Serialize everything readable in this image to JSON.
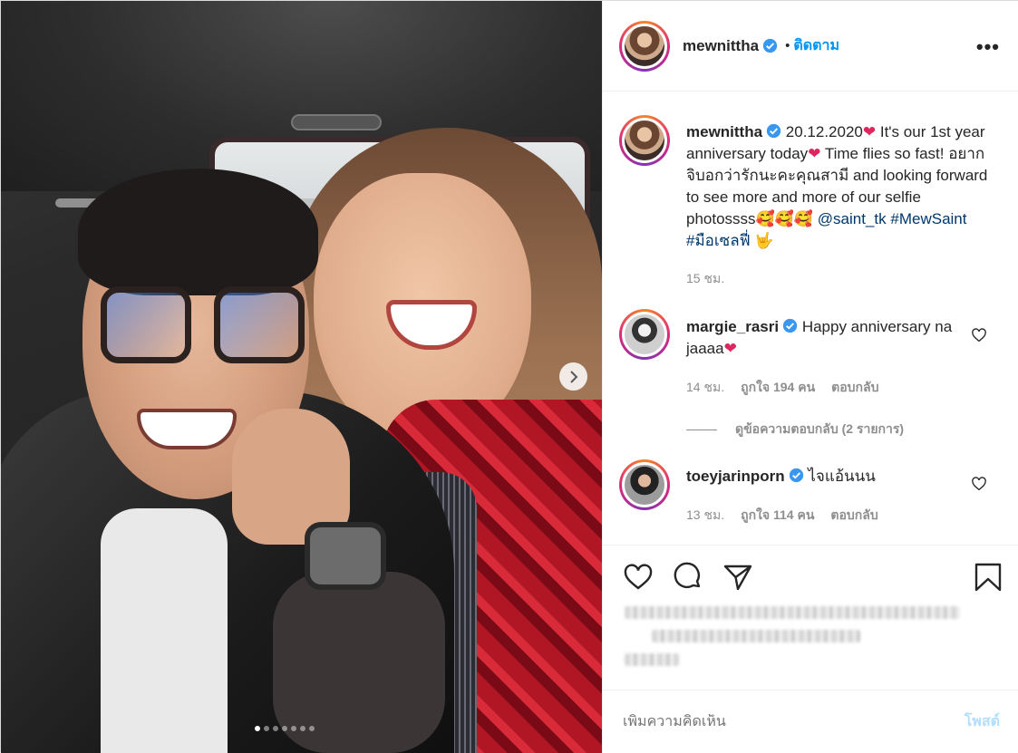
{
  "post": {
    "username": "mewnittha",
    "separator": "•",
    "follow_label": "ติดตาม",
    "more_label": "•••",
    "caption": {
      "part1": "20.12.2020",
      "part2": " It's our 1st year anniversary today",
      "part3": " Time flies so fast! อยากจิบอกว่ารักนะคะคุณสามี and looking forward to see more and more of our selfie photossss",
      "emoji_faces": "🥰🥰🥰",
      "mention": "@saint_tk",
      "hashtag1": "#MewSaint",
      "hashtag2": "#มือเซลฟี่",
      "time": "15 ชม."
    },
    "comments": [
      {
        "username": "margie_rasri",
        "text": "Happy anniversary na jaaaa",
        "time": "14 ชม.",
        "likes": "ถูกใจ 194 คน",
        "reply": "ตอบกลับ",
        "view_replies": "ดูข้อความตอบกลับ (2 รายการ)"
      },
      {
        "username": "toeyjarinporn",
        "text": "ไจแอ้นนน",
        "time": "13 ชม.",
        "likes": "ถูกใจ 114 คน",
        "reply": "ตอบกลับ"
      }
    ],
    "add_comment_placeholder": "เพิ่มความคิดเห็น",
    "post_button": "โพสต์",
    "carousel": {
      "slides": 7,
      "active": 1
    }
  },
  "icons": {
    "verified": "verified-badge-icon",
    "heart": "heart-icon",
    "comment": "comment-icon",
    "share": "share-icon",
    "bookmark": "bookmark-icon",
    "next": "chevron-right-icon"
  },
  "colors": {
    "accent": "#0095f6",
    "text": "#262626",
    "muted": "#8e8e8e",
    "link": "#00376b",
    "post_disabled": "#b2dffc"
  }
}
